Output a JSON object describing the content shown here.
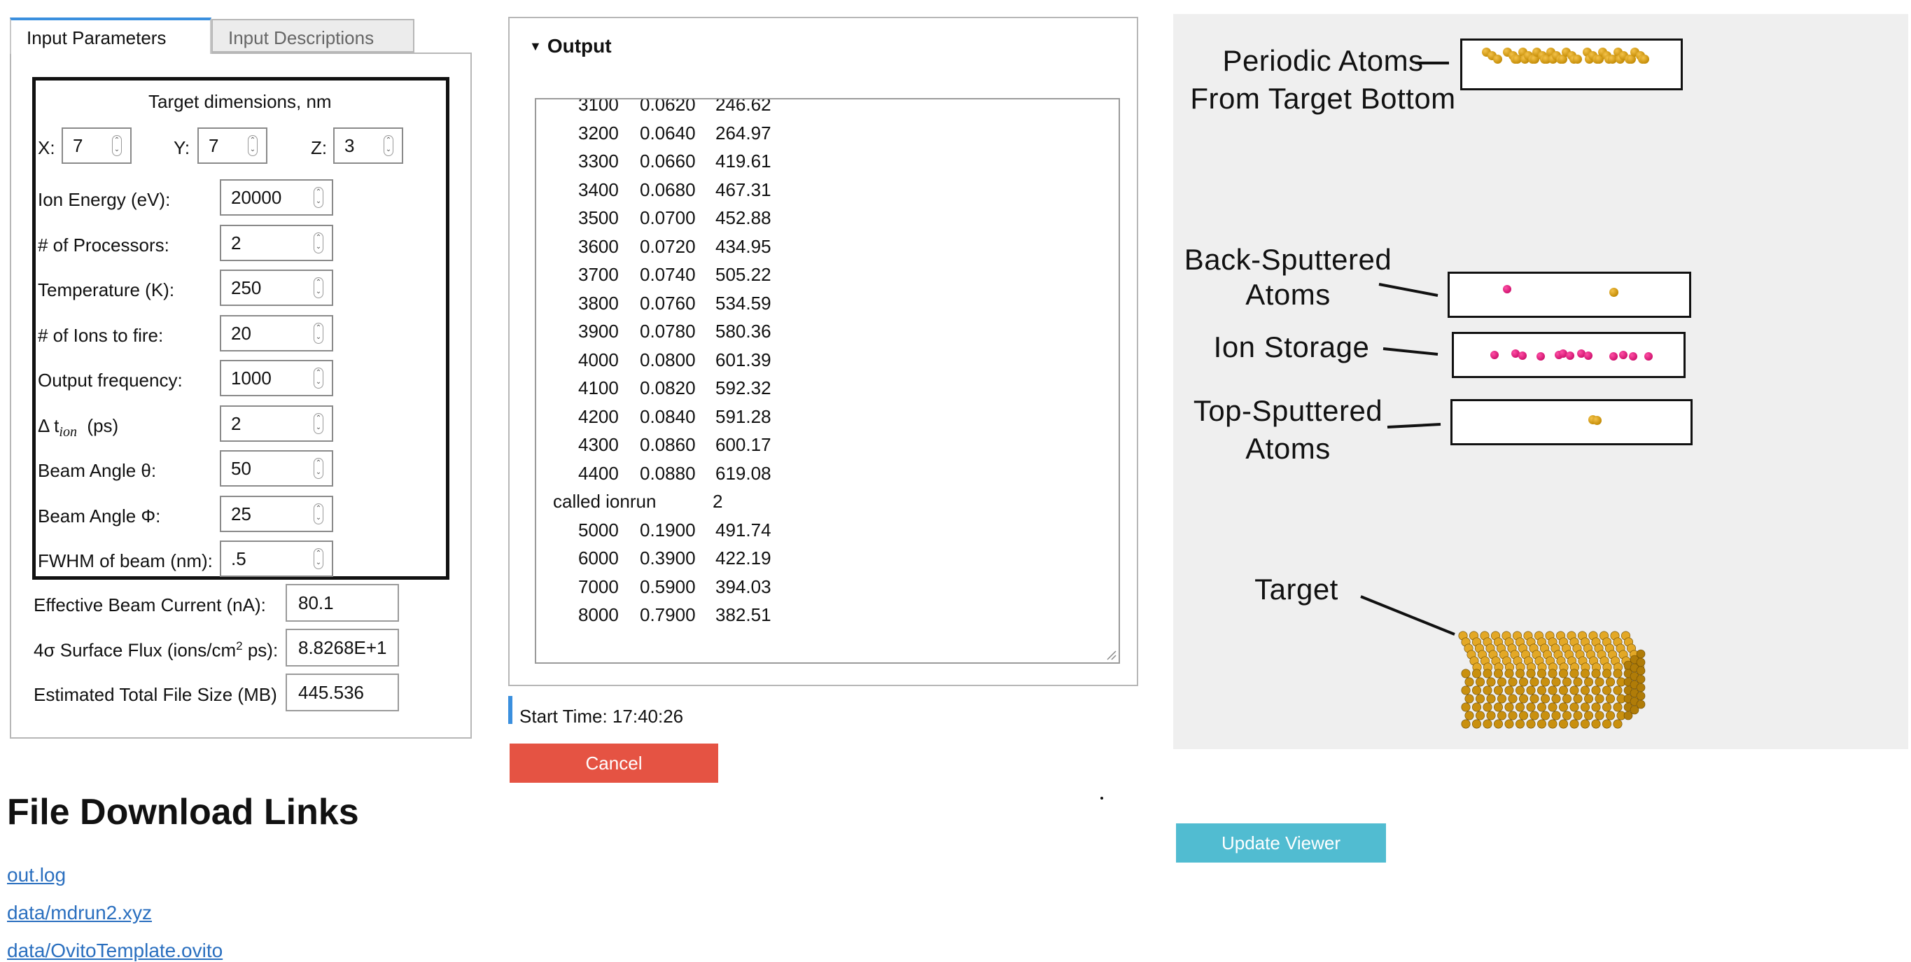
{
  "tabs": {
    "active": "Input Parameters",
    "inactive": "Input Descriptions"
  },
  "form": {
    "target_heading": "Target dimensions, nm",
    "x_label": "X:",
    "x_value": "7",
    "y_label": "Y:",
    "y_value": "7",
    "z_label": "Z:",
    "z_value": "3",
    "rows": [
      {
        "label": "Ion Energy (eV):",
        "value": "20000"
      },
      {
        "label": "# of Processors:",
        "value": "2"
      },
      {
        "label": "Temperature (K):",
        "value": "250"
      },
      {
        "label": "# of Ions to fire:",
        "value": "20"
      },
      {
        "label": "Output frequency:",
        "value": "1000"
      },
      {
        "label": "Δ t",
        "sub": "ion",
        "label_suffix": "(ps)",
        "value": "2"
      },
      {
        "label": "Beam Angle θ:",
        "value": "50"
      },
      {
        "label": "Beam Angle Φ:",
        "value": "25"
      },
      {
        "label": "FWHM of beam (nm):",
        "value": ".5"
      }
    ],
    "computed": [
      {
        "label": "Effective Beam Current (nA):",
        "value": "80.1"
      },
      {
        "label": "4σ Surface Flux (ions/cm",
        "sup": "2",
        "label_suffix": " ps):",
        "value": "8.8268E+1"
      },
      {
        "label": "Estimated Total File Size (MB)",
        "value": "445.536"
      }
    ]
  },
  "output": {
    "title": "Output",
    "lines": [
      [
        "3100",
        "0.0620",
        "246.62"
      ],
      [
        "3200",
        "0.0640",
        "264.97"
      ],
      [
        "3300",
        "0.0660",
        "419.61"
      ],
      [
        "3400",
        "0.0680",
        "467.31"
      ],
      [
        "3500",
        "0.0700",
        "452.88"
      ],
      [
        "3600",
        "0.0720",
        "434.95"
      ],
      [
        "3700",
        "0.0740",
        "505.22"
      ],
      [
        "3800",
        "0.0760",
        "534.59"
      ],
      [
        "3900",
        "0.0780",
        "580.36"
      ],
      [
        "4000",
        "0.0800",
        "601.39"
      ],
      [
        "4100",
        "0.0820",
        "592.32"
      ],
      [
        "4200",
        "0.0840",
        "591.28"
      ],
      [
        "4300",
        "0.0860",
        "600.17"
      ],
      [
        "4400",
        "0.0880",
        "619.08"
      ]
    ],
    "called_label": "called ionrun",
    "called_value": "2",
    "lines2": [
      [
        "5000",
        "0.1900",
        "491.74"
      ],
      [
        "6000",
        "0.3900",
        "422.19"
      ],
      [
        "7000",
        "0.5900",
        "394.03"
      ],
      [
        "8000",
        "0.7900",
        "382.51"
      ]
    ],
    "start_time": "Start Time: 17:40:26",
    "cancel": "Cancel"
  },
  "viewer": {
    "labels": {
      "periodic": [
        "Periodic Atoms",
        "From Target Bottom"
      ],
      "back": [
        "Back-Sputtered",
        "Atoms"
      ],
      "ion_storage": "Ion Storage",
      "top": [
        "Top-Sputtered",
        "Atoms"
      ],
      "target": "Target"
    },
    "update_button": "Update Viewer",
    "colors": {
      "target_atom": "#e0a521",
      "ion_atom": "#e0207f"
    }
  },
  "downloads": {
    "heading": "File Download Links",
    "links": [
      "out.log",
      "data/mdrun2.xyz",
      "data/OvitoTemplate.ovito"
    ]
  }
}
